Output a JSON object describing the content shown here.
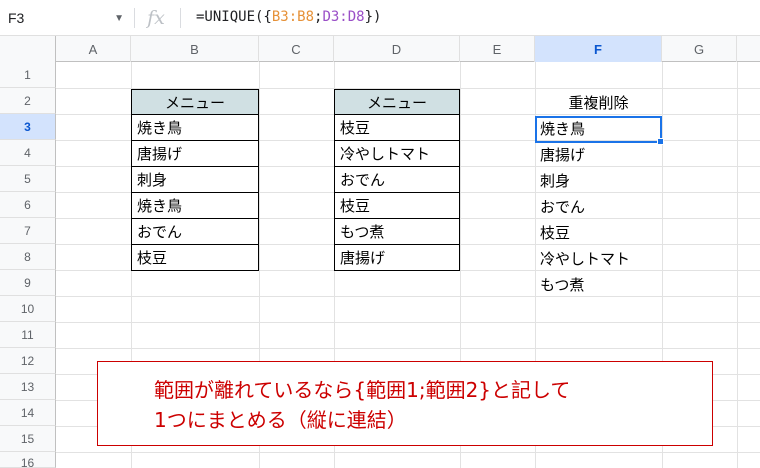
{
  "formula_bar": {
    "name_box": "F3",
    "fx_symbol": "fx",
    "formula_prefix": "=UNIQUE({",
    "ref_b": "B3:B8",
    "sep": ";",
    "ref_d": "D3:D8",
    "formula_suffix": "})"
  },
  "columns": [
    "A",
    "B",
    "C",
    "D",
    "E",
    "F",
    "G"
  ],
  "rows": [
    "1",
    "2",
    "3",
    "4",
    "5",
    "6",
    "7",
    "8",
    "9",
    "10",
    "11",
    "12",
    "13",
    "14",
    "15",
    "16"
  ],
  "table_b": {
    "header": "メニュー",
    "items": [
      "焼き鳥",
      "唐揚げ",
      "刺身",
      "焼き鳥",
      "おでん",
      "枝豆"
    ]
  },
  "table_d": {
    "header": "メニュー",
    "items": [
      "枝豆",
      "冷やしトマト",
      "おでん",
      "枝豆",
      "もつ煮",
      "唐揚げ"
    ]
  },
  "result_f": {
    "header": "重複削除",
    "items": [
      "焼き鳥",
      "唐揚げ",
      "刺身",
      "おでん",
      "枝豆",
      "冷やしトマト",
      "もつ煮"
    ]
  },
  "note": {
    "line1": "範囲が離れているなら{範囲1;範囲2}と記して",
    "line2": "1つにまとめる（縦に連結）"
  },
  "colors": {
    "header_fill": "#d0e0e3",
    "selection": "#1a73e8",
    "note": "#cc0000",
    "ref_b": "#e69138",
    "ref_d": "#9a4fc7"
  }
}
